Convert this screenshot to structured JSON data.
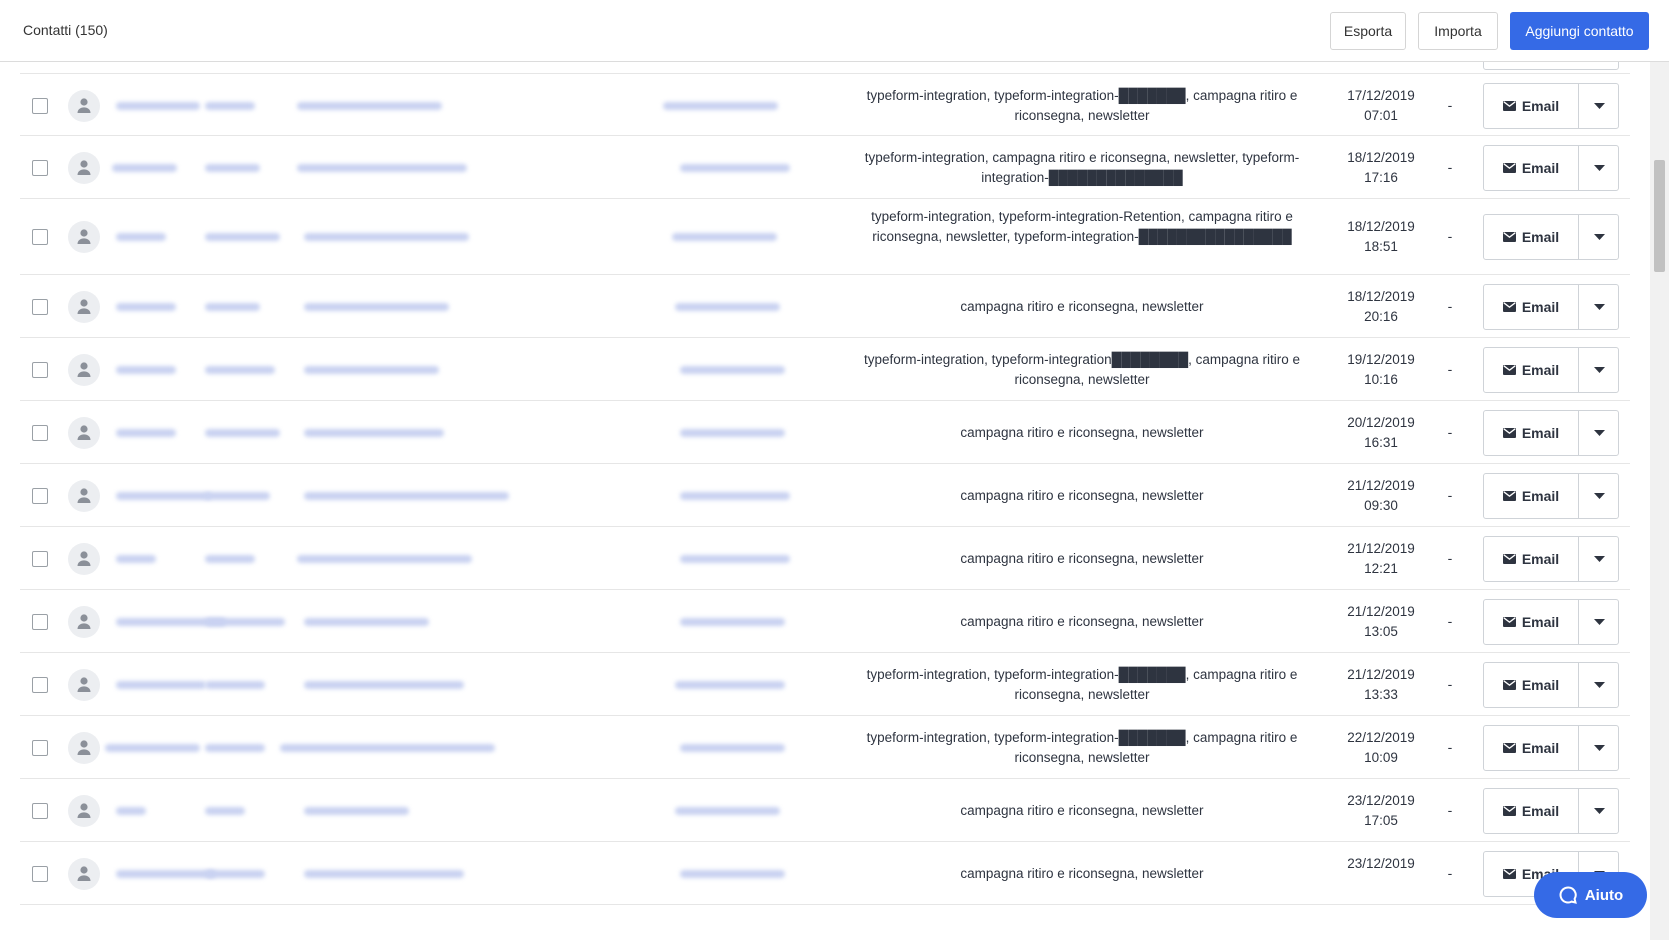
{
  "header": {
    "title": "Contatti (150)",
    "export_label": "Esporta",
    "import_label": "Importa",
    "add_label": "Aggiungi contatto"
  },
  "rows": [
    {
      "tags": "typeform-integration, typeform-integration-███████, campagna ritiro e riconsegna, newsletter",
      "date": "17/12/2019",
      "time": "07:01",
      "extra": "-",
      "action": "Email"
    },
    {
      "tags": "typeform-integration, campagna ritiro e riconsegna, newsletter, typeform-integration-██████████████",
      "date": "18/12/2019",
      "time": "17:16",
      "extra": "-",
      "action": "Email"
    },
    {
      "tags": "typeform-integration, typeform-integration-Retention, campagna ritiro e riconsegna, newsletter, typeform-integration-████████████████",
      "date": "18/12/2019",
      "time": "18:51",
      "extra": "-",
      "action": "Email"
    },
    {
      "tags": "campagna ritiro e riconsegna, newsletter",
      "date": "18/12/2019",
      "time": "20:16",
      "extra": "-",
      "action": "Email"
    },
    {
      "tags": "typeform-integration, typeform-integration████████, campagna ritiro e riconsegna, newsletter",
      "date": "19/12/2019",
      "time": "10:16",
      "extra": "-",
      "action": "Email"
    },
    {
      "tags": "campagna ritiro e riconsegna, newsletter",
      "date": "20/12/2019",
      "time": "16:31",
      "extra": "-",
      "action": "Email"
    },
    {
      "tags": "campagna ritiro e riconsegna, newsletter",
      "date": "21/12/2019",
      "time": "09:30",
      "extra": "-",
      "action": "Email"
    },
    {
      "tags": "campagna ritiro e riconsegna, newsletter",
      "date": "21/12/2019",
      "time": "12:21",
      "extra": "-",
      "action": "Email"
    },
    {
      "tags": "campagna ritiro e riconsegna, newsletter",
      "date": "21/12/2019",
      "time": "13:05",
      "extra": "-",
      "action": "Email"
    },
    {
      "tags": "typeform-integration, typeform-integration-███████, campagna ritiro e riconsegna, newsletter",
      "date": "21/12/2019",
      "time": "13:33",
      "extra": "-",
      "action": "Email"
    },
    {
      "tags": "typeform-integration, typeform-integration-███████, campagna ritiro e riconsegna, newsletter",
      "date": "22/12/2019",
      "time": "10:09",
      "extra": "-",
      "action": "Email"
    },
    {
      "tags": "campagna ritiro e riconsegna, newsletter",
      "date": "23/12/2019",
      "time": "17:05",
      "extra": "-",
      "action": "Email"
    },
    {
      "tags": "campagna ritiro e riconsegna, newsletter",
      "date": "23/12/2019",
      "time": "",
      "extra": "-",
      "action": "Email"
    }
  ],
  "help": {
    "label": "Aiuto"
  },
  "colors": {
    "primary": "#356ae6",
    "border": "#e6e6e6"
  },
  "icons": {
    "avatar": "person-icon",
    "email": "envelope-icon",
    "dropdown": "caret-down-icon",
    "help": "chat-bubble-icon"
  }
}
